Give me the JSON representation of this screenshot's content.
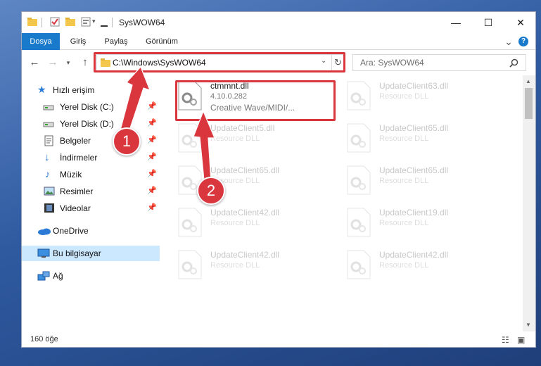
{
  "window": {
    "title": "SysWOW64",
    "minimize_glyph": "—",
    "maximize_glyph": "☐",
    "close_glyph": "✕"
  },
  "ribbon": {
    "tabs": [
      "Dosya",
      "Giriş",
      "Paylaş",
      "Görünüm"
    ],
    "expand_glyph": "⌄",
    "help_glyph": "?"
  },
  "address": {
    "path": "C:\\Windows\\SysWOW64",
    "search_placeholder": "Ara: SysWOW64"
  },
  "nav_pane": {
    "quick_access": "Hızlı erişim",
    "items": [
      {
        "label": "Yerel Disk (C:)",
        "icon": "drive-icon"
      },
      {
        "label": "Yerel Disk (D:)",
        "icon": "drive-icon"
      },
      {
        "label": "Belgeler",
        "icon": "documents-icon"
      },
      {
        "label": "İndirmeler",
        "icon": "downloads-icon"
      },
      {
        "label": "Müzik",
        "icon": "music-icon"
      },
      {
        "label": "Resimler",
        "icon": "pictures-icon"
      },
      {
        "label": "Videolar",
        "icon": "videos-icon"
      }
    ],
    "onedrive": "OneDrive",
    "this_pc": "Bu bilgisayar",
    "network": "Ağ"
  },
  "files": [
    {
      "name": "ctmmnt.dll",
      "desc": "4.10.0.282",
      "desc2": "Creative Wave/MIDI/..."
    },
    {
      "name": "UpdateClient63.dll",
      "desc": "Resource DLL"
    },
    {
      "name": "UpdateClient5.dll",
      "desc": "Resource DLL"
    },
    {
      "name": "UpdateClient65.dll",
      "desc": "Resource DLL"
    },
    {
      "name": "UpdateClient65.dll",
      "desc": "Resource DLL"
    },
    {
      "name": "UpdateClient65.dll",
      "desc": "Resource DLL"
    },
    {
      "name": "UpdateClient42.dll",
      "desc": "Resource DLL"
    },
    {
      "name": "UpdateClient19.dll",
      "desc": "Resource DLL"
    },
    {
      "name": "UpdateClient42.dll",
      "desc": "Resource DLL"
    },
    {
      "name": "UpdateClient42.dll",
      "desc": "Resource DLL"
    }
  ],
  "status": {
    "count": "160 öğe"
  },
  "callouts": [
    "1",
    "2"
  ],
  "colors": {
    "accent": "#1979ca",
    "highlight": "#d9363e",
    "selection": "#cce8ff"
  }
}
